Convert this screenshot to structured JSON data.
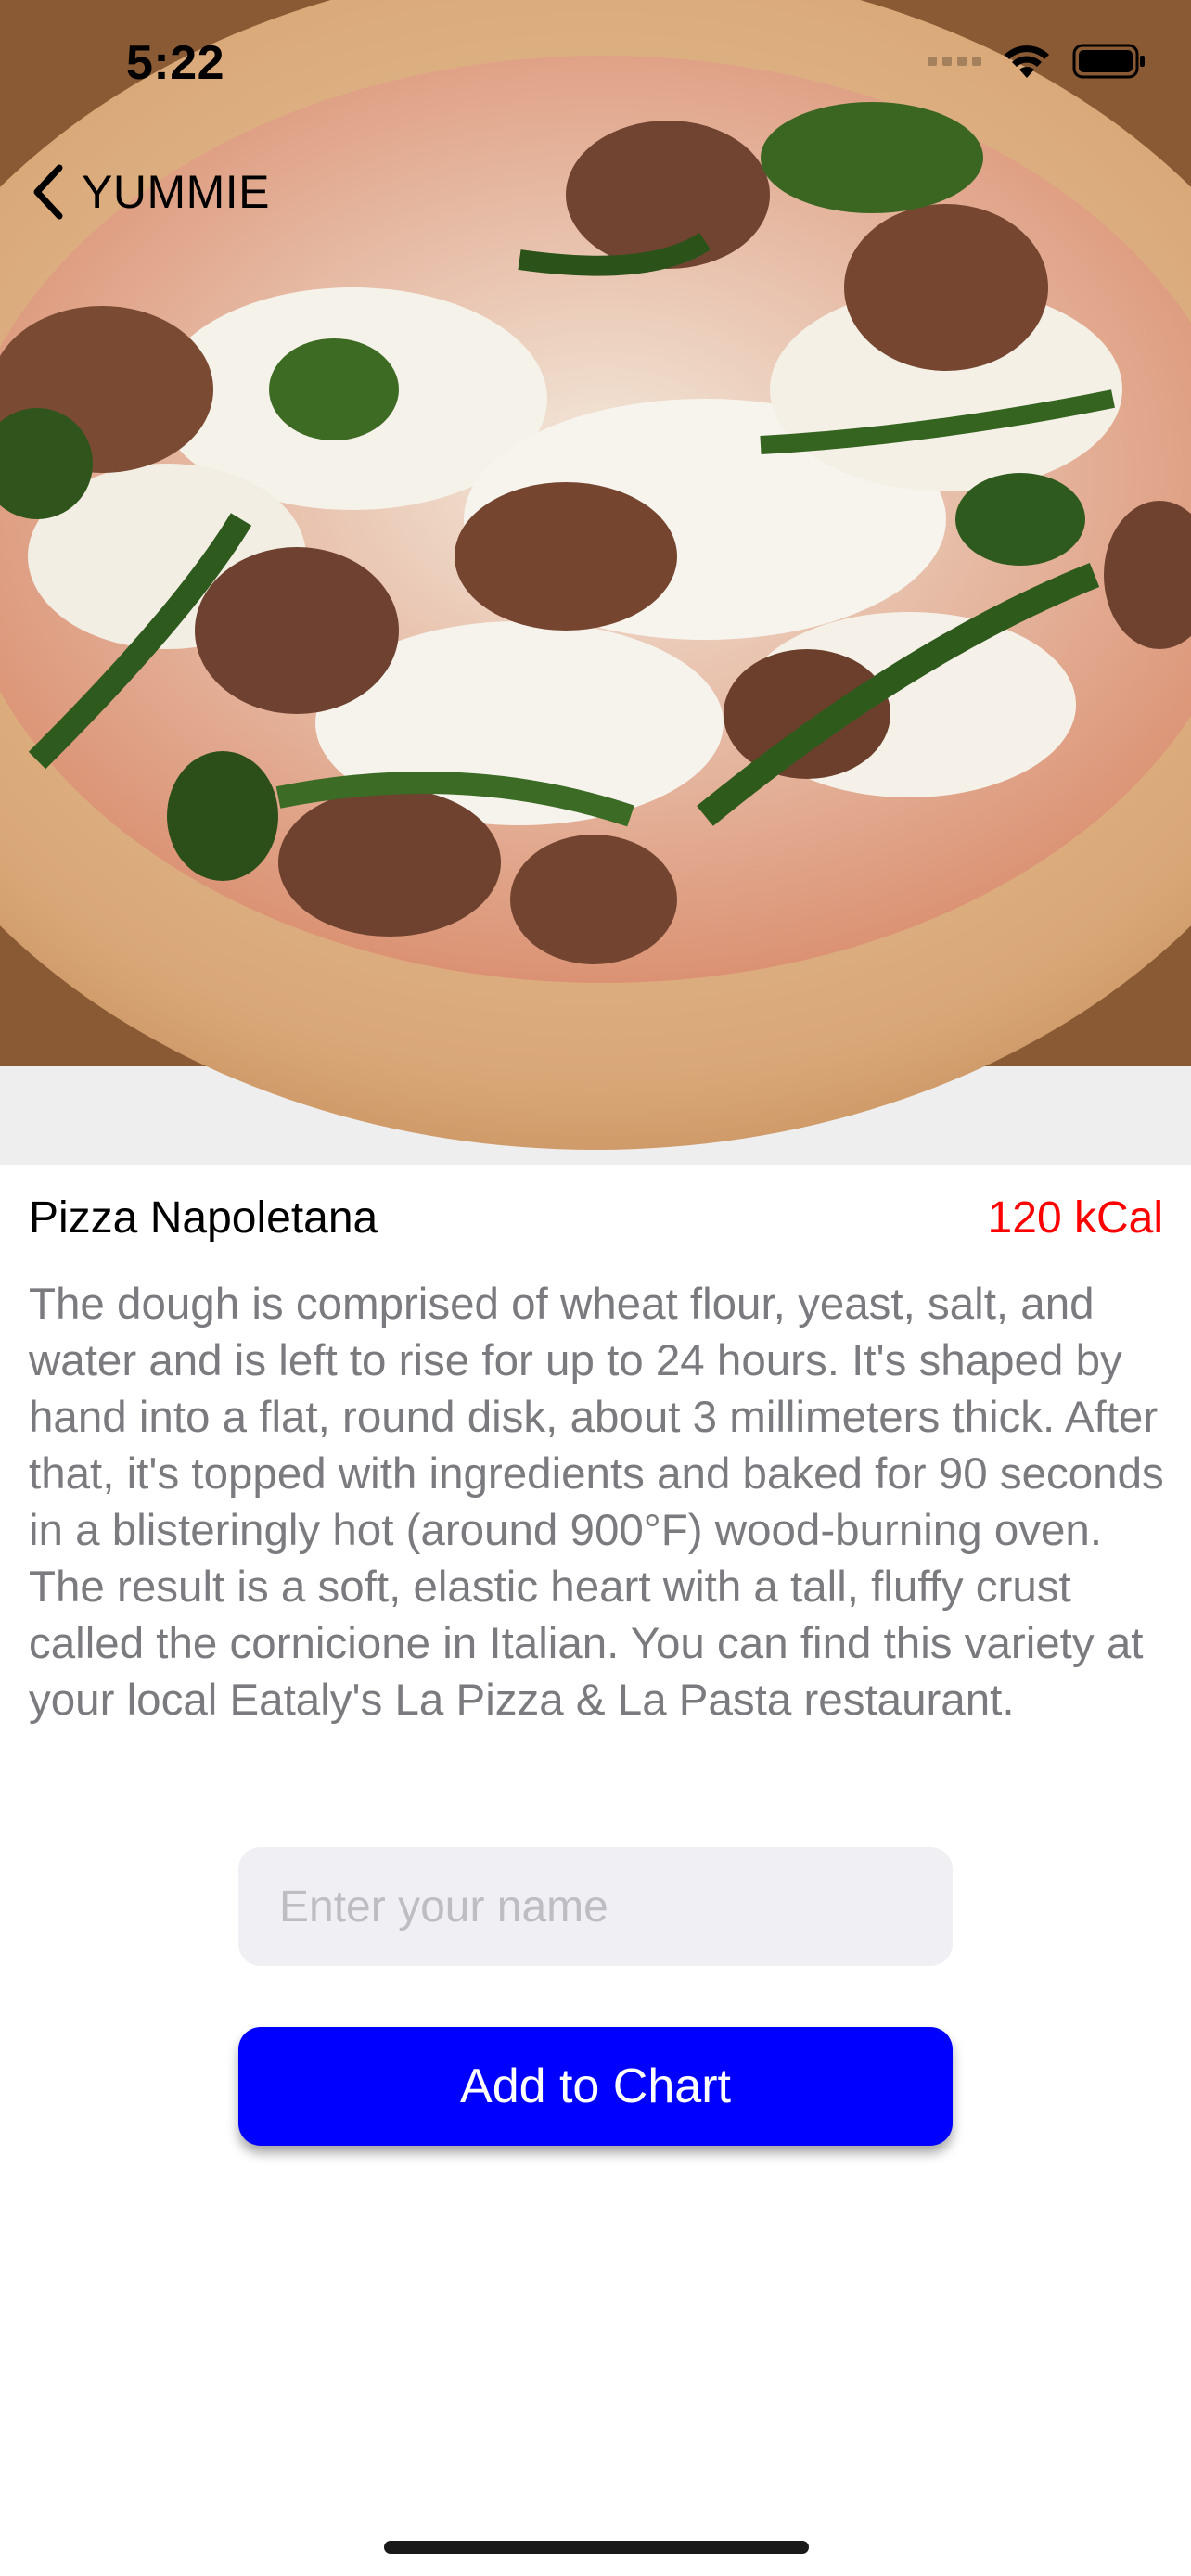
{
  "status_bar": {
    "time": "5:22",
    "icons": [
      "cellular-signal-icon",
      "wifi-icon",
      "battery-icon"
    ]
  },
  "nav": {
    "back_label": "YUMMIE",
    "back_icon": "chevron-left-icon"
  },
  "hero": {
    "image": "pizza-photo"
  },
  "item": {
    "title": "Pizza Napoletana",
    "calories": "120 kCal",
    "description": "The dough is comprised of wheat flour, yeast, salt, and water and is left to rise for up to 24 hours. It's shaped by hand into a flat, round disk, about 3 millimeters thick. After that, it's topped with ingredients and baked for 90 seconds in a blisteringly hot (around 900°F) wood-burning oven. The result is a soft, elastic heart with a tall, fluffy crust called the cornicione in Italian. You can find this variety at your local Eataly's La Pizza & La Pasta restaurant."
  },
  "form": {
    "name_value": "",
    "name_placeholder": "Enter your name",
    "add_button_label": "Add to Chart"
  },
  "colors": {
    "accent_button": "#0000ff",
    "calories": "#ff0000",
    "description_text": "#7b7b7f",
    "input_background": "#efeff4"
  }
}
